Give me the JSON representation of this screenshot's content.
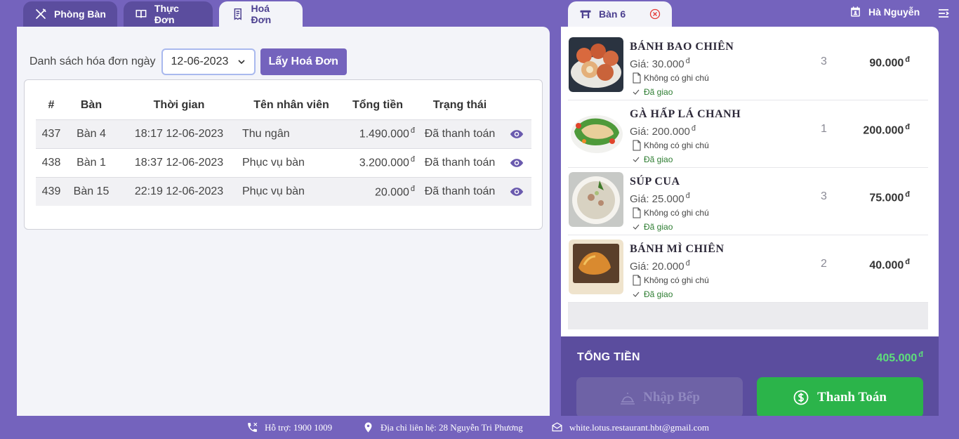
{
  "tabs": [
    {
      "label": "Phòng Bàn",
      "icon": "utensils-icon"
    },
    {
      "label": "Thực Đơn",
      "icon": "book-icon"
    },
    {
      "label": "Hoá Đơn",
      "icon": "receipt-icon",
      "active": true
    }
  ],
  "invoices": {
    "filter_label": "Danh sách hóa đơn ngày",
    "date_value": "12-06-2023",
    "fetch_button": "Lấy Hoá Đơn",
    "columns": [
      "#",
      "Bàn",
      "Thời gian",
      "Tên nhân viên",
      "Tổng tiền",
      "Trạng thái"
    ],
    "currency": "đ",
    "rows": [
      {
        "id": "437",
        "table": "Bàn 4",
        "time": "18:17 12-06-2023",
        "staff": "Thu ngân",
        "total": "1.490.000",
        "status": "Đã thanh toán"
      },
      {
        "id": "438",
        "table": "Bàn 1",
        "time": "18:37 12-06-2023",
        "staff": "Phục vụ bàn",
        "total": "3.200.000",
        "status": "Đã thanh toán"
      },
      {
        "id": "439",
        "table": "Bàn 15",
        "time": "22:19 12-06-2023",
        "staff": "Phục vụ bàn",
        "total": "20.000",
        "status": "Đã thanh toán"
      }
    ]
  },
  "order_tab": {
    "label": "Bàn 6"
  },
  "user": {
    "name": "Hà Nguyễn"
  },
  "order": {
    "currency": "đ",
    "items": [
      {
        "name": "BÁNH BAO CHIÊN",
        "price": "Giá: 30.000",
        "note": "Không có ghi chú",
        "status": "Đã giao",
        "qty": "3",
        "total": "90.000"
      },
      {
        "name": "GÀ HẤP LÁ CHANH",
        "price": "Giá: 200.000",
        "note": "Không có ghi chú",
        "status": "Đã giao",
        "qty": "1",
        "total": "200.000"
      },
      {
        "name": "SÚP CUA",
        "price": "Giá: 25.000",
        "note": "Không có ghi chú",
        "status": "Đã giao",
        "qty": "3",
        "total": "75.000"
      },
      {
        "name": "BÁNH MÌ CHIÊN",
        "price": "Giá: 20.000",
        "note": "Không có ghi chú",
        "status": "Đã giao",
        "qty": "2",
        "total": "40.000"
      }
    ],
    "total_label": "TỔNG TIỀN",
    "total_value": "405.000",
    "kitchen_button": "Nhập Bếp",
    "pay_button": "Thanh Toán"
  },
  "footer": {
    "support": "Hỗ trợ: 1900 1009",
    "address": "Địa chỉ liên hệ: 28 Nguyễn Tri Phương",
    "email": "white.lotus.restaurant.hbt@gmail.com"
  },
  "colors": {
    "accent": "#7463bd",
    "accent_dark": "#5b4d9e",
    "success": "#2bb44a",
    "total_green": "#5ee07a"
  }
}
